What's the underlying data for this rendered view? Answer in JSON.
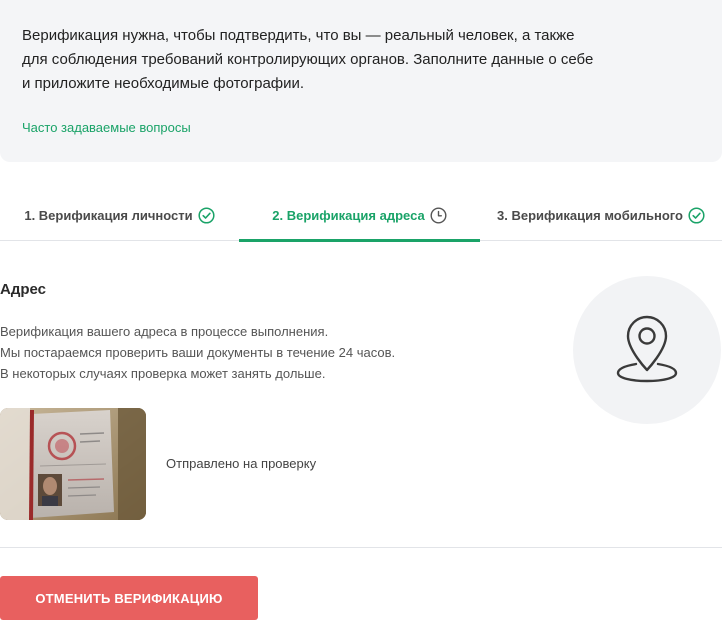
{
  "info": {
    "lines": [
      "Верификация нужна, чтобы подтвердить, что вы — реальный человек, а также",
      "для соблюдения требований контролирующих органов. Заполните данные о себе",
      "и приложите необходимые фотографии."
    ],
    "faq_link": "Часто задаваемые вопросы"
  },
  "tabs": [
    {
      "label": "1. Верификация личности",
      "status_icon": "check-circle-icon"
    },
    {
      "label": "2. Верификация адреса",
      "status_icon": "clock-icon"
    },
    {
      "label": "3. Верификация мобильного",
      "status_icon": "check-circle-icon"
    }
  ],
  "address": {
    "title": "Адрес",
    "description": [
      "Верификация вашего адреса в процессе выполнения.",
      "Мы постараемся проверить ваши документы в течение 24 часов.",
      "В некоторых случаях проверка может занять дольше."
    ],
    "document_status": "Отправлено на проверку",
    "icon": "map-pin-icon"
  },
  "actions": {
    "cancel_label": "ОТМЕНИТЬ ВЕРИФИКАЦИЮ"
  },
  "colors": {
    "accent": "#1aa368",
    "danger": "#e8605f",
    "panel": "#f4f5f7"
  }
}
